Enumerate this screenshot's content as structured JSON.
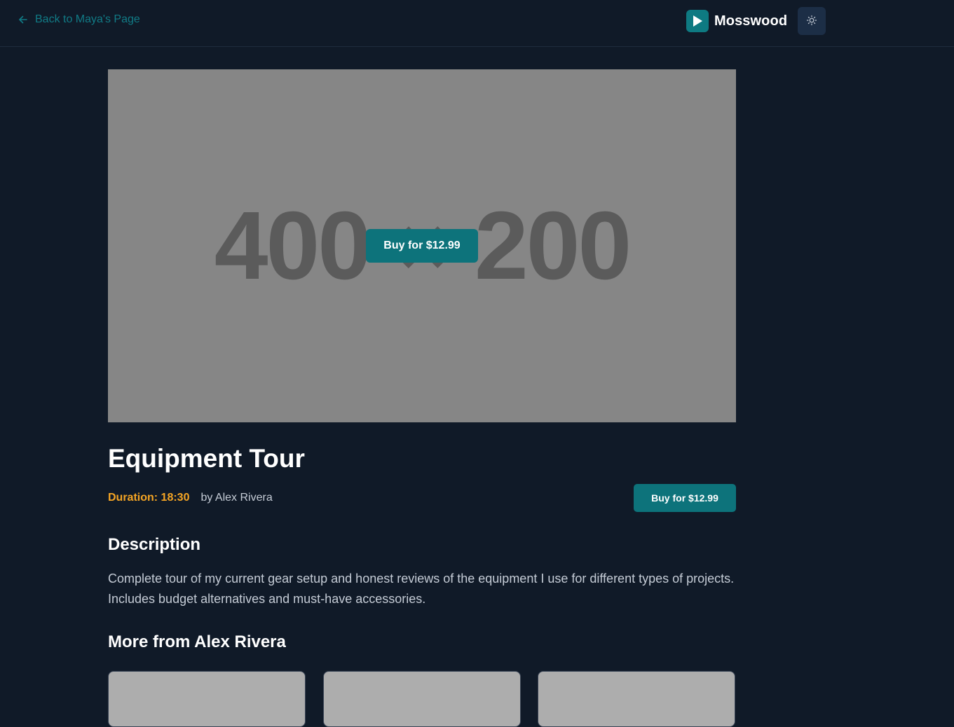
{
  "header": {
    "back_label": "Back to Maya's Page",
    "brand_name": "Mosswood",
    "theme_toggle_icon": "sun-icon",
    "brand_logo_icon": "play-icon"
  },
  "hero": {
    "placeholder_width": "400",
    "placeholder_separator": "×",
    "placeholder_height": "200",
    "buy_label": "Buy for $12.99"
  },
  "video": {
    "title": "Equipment Tour",
    "duration": "Duration: 18:30",
    "author": "by Alex Rivera",
    "buy_label": "Buy for $12.99"
  },
  "description": {
    "heading": "Description",
    "text": "Complete tour of my current gear setup and honest reviews of the equipment I use for different types of projects. Includes budget alternatives and must-have accessories."
  },
  "more": {
    "heading": "More from Alex Rivera",
    "cards": [
      {
        "name": "related-video-card-1"
      },
      {
        "name": "related-video-card-2"
      },
      {
        "name": "related-video-card-3"
      }
    ]
  },
  "colors": {
    "background": "#101a28",
    "accent": "#0d737b",
    "duration": "#f5a524",
    "muted_text": "#c5ccd6"
  }
}
